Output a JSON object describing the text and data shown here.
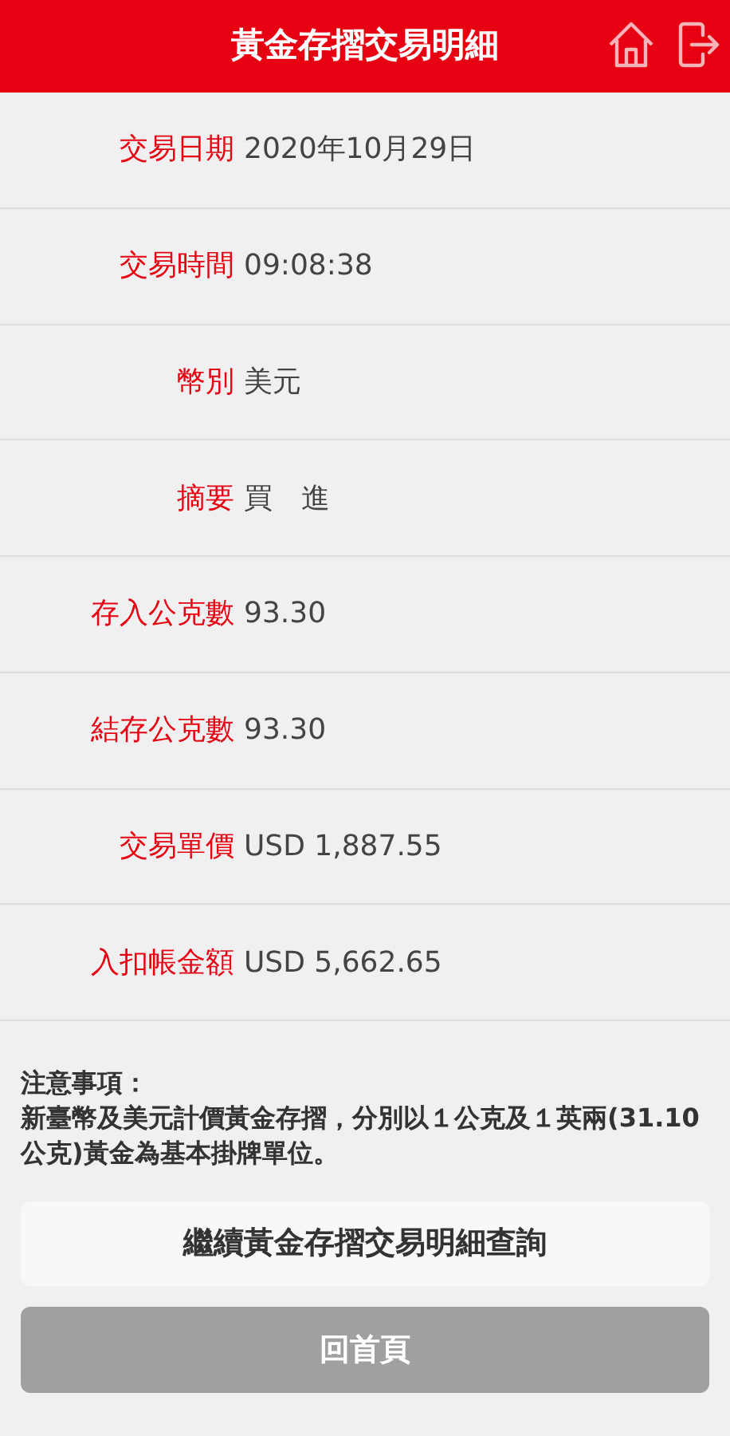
{
  "header": {
    "title": "黃金存摺交易明細"
  },
  "rows": [
    {
      "label": "交易日期",
      "value": "2020年10月29日"
    },
    {
      "label": "交易時間",
      "value": "09:08:38"
    },
    {
      "label": "幣別",
      "value": "美元"
    },
    {
      "label": "摘要",
      "value": "買　進"
    },
    {
      "label": "存入公克數",
      "value": "93.30"
    },
    {
      "label": "結存公克數",
      "value": "93.30"
    },
    {
      "label": "交易單價",
      "value": "USD 1,887.55"
    },
    {
      "label": "入扣帳金額",
      "value": "USD 5,662.65"
    }
  ],
  "notice": {
    "title": "注意事項：",
    "text": "新臺幣及美元計價黃金存摺，分別以１公克及１英兩(31.10公克)黃金為基本掛牌單位。"
  },
  "buttons": [
    {
      "label": "繼續黃金存摺交易明細查詢",
      "kind": "secondary"
    },
    {
      "label": "回首頁",
      "kind": "primary"
    }
  ]
}
